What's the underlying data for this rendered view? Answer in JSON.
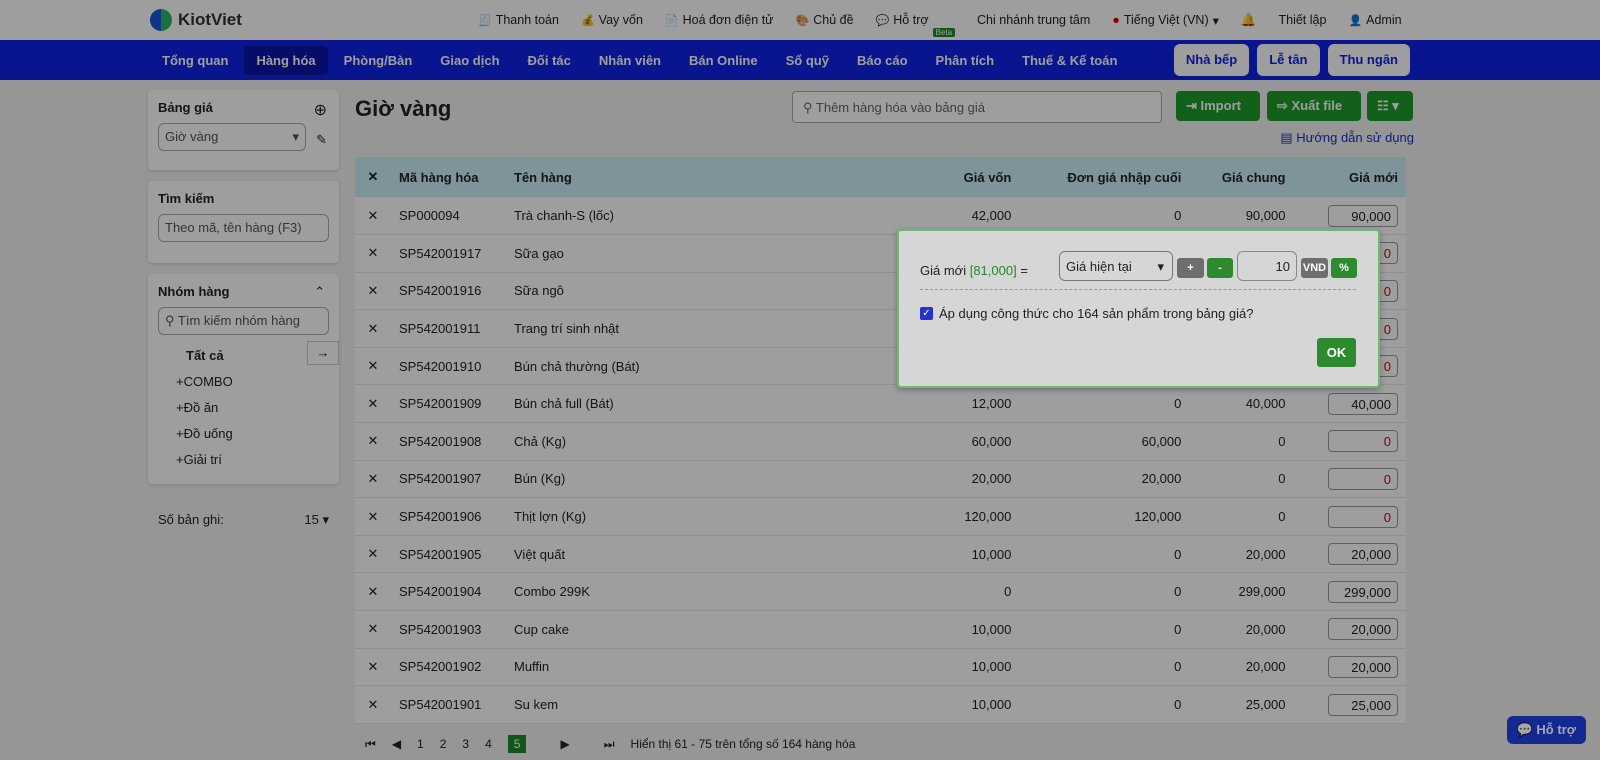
{
  "brand": "KiotViet",
  "toplinks": [
    "Thanh toán",
    "Vay vốn",
    "Hoá đơn điện tử",
    "Chủ đề",
    "Hỗ trợ",
    "Chi nhánh trung tâm",
    "Tiếng Việt (VN)",
    "Thiết lập",
    "Admin"
  ],
  "beta": "Beta",
  "nav": [
    "Tổng quan",
    "Hàng hóa",
    "Phòng/Bàn",
    "Giao dịch",
    "Đối tác",
    "Nhân viên",
    "Bán Online",
    "Sổ quỹ",
    "Báo cáo",
    "Phân tích",
    "Thuế & Kế toán"
  ],
  "navbtns": [
    "Nhà bếp",
    "Lễ tân",
    "Thu ngân"
  ],
  "side": {
    "pricebook_title": "Bảng giá",
    "pricebook_value": "Giờ vàng",
    "search_title": "Tìm kiếm",
    "search_placeholder": "Theo mã, tên hàng (F3)",
    "group_title": "Nhóm hàng",
    "group_placeholder": "Tìm kiếm nhóm hàng",
    "groups": [
      "Tất cả",
      "COMBO",
      "Đồ ăn",
      "Đồ uống",
      "Giải trí"
    ],
    "records_label": "Số bản ghi:",
    "records_value": "15"
  },
  "main": {
    "title": "Giờ vàng",
    "search_placeholder": "Thêm hàng hóa vào bảng giá",
    "import": "Import",
    "export": "Xuất file",
    "help": "Hướng dẫn sử dụng"
  },
  "columns": [
    "Mã hàng hóa",
    "Tên hàng",
    "Giá vốn",
    "Đơn giá nhập cuối",
    "Giá chung",
    "Giá mới"
  ],
  "rows": [
    [
      "SP000094",
      "Trà chanh-S (lốc)",
      "42,000",
      "0",
      "90,000",
      "90,000"
    ],
    [
      "SP542001917",
      "Sữa gạo",
      "",
      "",
      "",
      "0"
    ],
    [
      "SP542001916",
      "Sữa ngô",
      "",
      "",
      "",
      "0"
    ],
    [
      "SP542001911",
      "Trang trí sinh nhật",
      "",
      "",
      "",
      "0"
    ],
    [
      "SP542001910",
      "Bún chả thường (Bát)",
      "",
      "",
      "",
      "0"
    ],
    [
      "SP542001909",
      "Bún chả full (Bát)",
      "12,000",
      "0",
      "40,000",
      "40,000"
    ],
    [
      "SP542001908",
      "Chả (Kg)",
      "60,000",
      "60,000",
      "0",
      "0"
    ],
    [
      "SP542001907",
      "Bún (Kg)",
      "20,000",
      "20,000",
      "0",
      "0"
    ],
    [
      "SP542001906",
      "Thịt lợn (Kg)",
      "120,000",
      "120,000",
      "0",
      "0"
    ],
    [
      "SP542001905",
      "Việt quất",
      "10,000",
      "0",
      "20,000",
      "20,000"
    ],
    [
      "SP542001904",
      "Combo 299K",
      "0",
      "0",
      "299,000",
      "299,000"
    ],
    [
      "SP542001903",
      "Cup cake",
      "10,000",
      "0",
      "20,000",
      "20,000"
    ],
    [
      "SP542001902",
      "Muffin",
      "10,000",
      "0",
      "20,000",
      "20,000"
    ],
    [
      "SP542001901",
      "Su kem",
      "10,000",
      "0",
      "25,000",
      "25,000"
    ]
  ],
  "pager": {
    "pages": [
      "1",
      "2",
      "3",
      "4",
      "5"
    ],
    "info": "Hiển thị 61 - 75 trên tổng số 164 hàng hóa"
  },
  "popup": {
    "label": "Giá mới",
    "value": "[81,000]",
    "eq": "=",
    "select": "Giá hiện tại",
    "plus": "+",
    "minus": "-",
    "amount": "10",
    "vnd": "VND",
    "pct": "%",
    "apply": "Áp dụng công thức cho 164 sản phẩm trong bảng giá?",
    "ok": "OK"
  },
  "support": "Hỗ trợ"
}
